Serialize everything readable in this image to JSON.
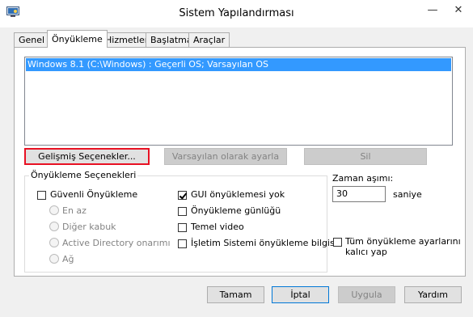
{
  "window": {
    "title": "Sistem Yapılandırması",
    "minimize_glyph": "—",
    "close_glyph": "✕",
    "icon": "msconfig-icon"
  },
  "tabs": [
    {
      "label": "Genel",
      "active": false
    },
    {
      "label": "Önyükleme",
      "active": true
    },
    {
      "label": "Hizmetler",
      "active": false
    },
    {
      "label": "Başlatma",
      "active": false
    },
    {
      "label": "Araçlar",
      "active": false
    }
  ],
  "os_list": {
    "selected_item": "Windows 8.1 (C:\\Windows) : Geçerli OS; Varsayılan OS"
  },
  "list_buttons": {
    "advanced": "Gelişmiş Seçenekler...",
    "set_default": "Varsayılan olarak ayarla",
    "delete": "Sil"
  },
  "boot_options": {
    "legend": "Önyükleme Seçenekleri",
    "safe_boot": {
      "label": "Güvenli Önyükleme",
      "checked": false
    },
    "safe_modes": [
      {
        "label": "En az",
        "enabled": false
      },
      {
        "label": "Diğer kabuk",
        "enabled": false
      },
      {
        "label": "Active Directory onarımı",
        "enabled": false
      },
      {
        "label": "Ağ",
        "enabled": false
      }
    ],
    "no_gui_boot": {
      "label": "GUI önyüklemesi yok",
      "checked": true
    },
    "boot_log": {
      "label": "Önyükleme günlüğü",
      "checked": false
    },
    "base_video": {
      "label": "Temel video",
      "checked": false
    },
    "os_boot_info": {
      "label": "İşletim Sistemi önyükleme bilgisi",
      "checked": false
    }
  },
  "timeout": {
    "label": "Zaman aşımı:",
    "value": "30",
    "unit": "saniye"
  },
  "permanent": {
    "label_line1": "Tüm önyükleme ayarlarını",
    "label_line2": "kalıcı yap",
    "checked": false
  },
  "footer_buttons": {
    "ok": "Tamam",
    "cancel": "İptal",
    "apply": "Uygula",
    "help": "Yardım"
  }
}
